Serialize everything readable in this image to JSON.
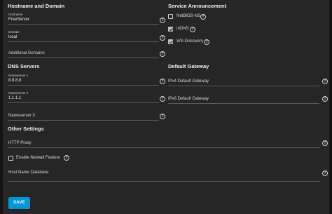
{
  "sections": {
    "hostname_domain": "Hostname and Domain",
    "service_announcement": "Service Announcement",
    "dns_servers": "DNS Servers",
    "default_gateway": "Default Gateway",
    "other_settings": "Other Settings"
  },
  "fields": {
    "hostname": {
      "label": "Hostname",
      "value": "FreeServer"
    },
    "domain": {
      "label": "Domain",
      "value": "local"
    },
    "additional_domains": {
      "label": "Additional Domains"
    },
    "nameserver1": {
      "label": "Nameserver 1",
      "value": "8.8.8.8"
    },
    "nameserver2": {
      "label": "Nameserver 2",
      "value": "1.1.1.1"
    },
    "nameserver3": {
      "label": "Nameserver 3"
    },
    "ipv4_gateway": {
      "label": "IPv4 Default Gateway"
    },
    "ipv6_gateway": {
      "label": "IPv6 Default Gateway"
    },
    "http_proxy": {
      "label": "HTTP Proxy"
    },
    "host_name_database": {
      "label": "Host Name Database"
    }
  },
  "checkboxes": {
    "netbios": {
      "label": "NetBIOS-NS",
      "checked": false
    },
    "mdns": {
      "label": "mDNS",
      "checked": true
    },
    "wsd": {
      "label": "WS-Discovery",
      "checked": true
    },
    "netwait": {
      "label": "Enable Netwait Feature",
      "checked": false
    }
  },
  "help_glyph": "?",
  "save_label": "SAVE",
  "colors": {
    "background": "#262626",
    "accent": "#0095d5",
    "page": "#141414"
  }
}
